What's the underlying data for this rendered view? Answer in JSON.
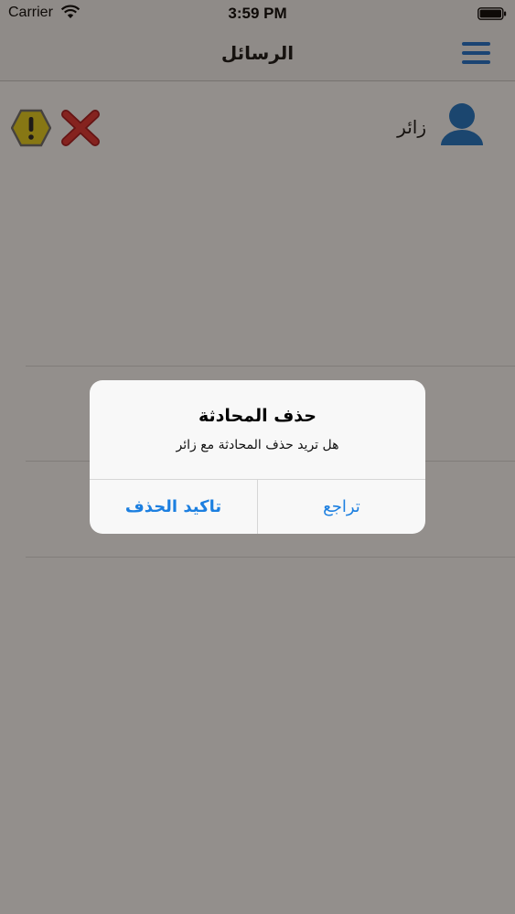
{
  "status_bar": {
    "carrier": "Carrier",
    "time": "3:59 PM"
  },
  "nav": {
    "title": "الرسائل",
    "menu_icon": "hamburger-menu-icon"
  },
  "conversation": {
    "name": "زائر",
    "avatar_icon": "user-avatar-icon",
    "report_icon": "warning-icon",
    "delete_icon": "close-icon"
  },
  "alert": {
    "title": "حذف المحادثة",
    "message": "هل تريد حذف المحادثة مع زائر",
    "confirm_label": "تاكيد الحذف",
    "cancel_label": "تراجع"
  },
  "colors": {
    "accent": "#1c7fe0",
    "warning_fill": "#e8d21a",
    "delete_red": "#d9262a",
    "avatar_blue": "#1a74c8"
  }
}
